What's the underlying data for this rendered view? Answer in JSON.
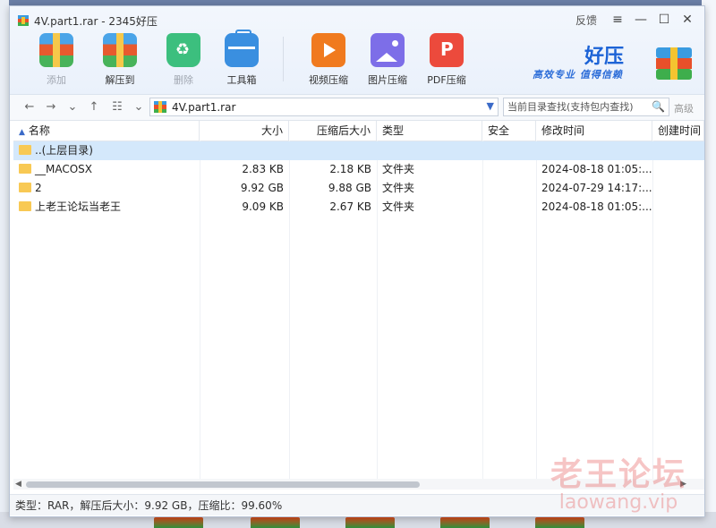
{
  "window": {
    "title": "4V.part1.rar - 2345好压"
  },
  "title_bar": {
    "feedback": "反馈"
  },
  "toolbar": {
    "add": "添加",
    "extract": "解压到",
    "delete": "删除",
    "tools": "工具箱",
    "video": "视频压缩",
    "image": "图片压缩",
    "pdf": "PDF压缩"
  },
  "brand": {
    "name": "好压",
    "slogan": "高效专业 值得信赖"
  },
  "address": {
    "path": "4V.part1.rar",
    "search_placeholder": "当前目录查找(支持包内查找)",
    "advanced": "高级"
  },
  "columns": {
    "name": "名称",
    "size": "大小",
    "packed": "压缩后大小",
    "type": "类型",
    "security": "安全",
    "modified": "修改时间",
    "created": "创建时间"
  },
  "files": [
    {
      "name": "..(上层目录)",
      "size": "",
      "packed": "",
      "type": "",
      "modified": ""
    },
    {
      "name": "__MACOSX",
      "size": "2.83 KB",
      "packed": "2.18 KB",
      "type": "文件夹",
      "modified": "2024-08-18 01:05:..."
    },
    {
      "name": "2",
      "size": "9.92 GB",
      "packed": "9.88 GB",
      "type": "文件夹",
      "modified": "2024-07-29 14:17:..."
    },
    {
      "name": "上老王论坛当老王",
      "size": "9.09 KB",
      "packed": "2.67 KB",
      "type": "文件夹",
      "modified": "2024-08-18 01:05:..."
    }
  ],
  "status": {
    "text": "类型：RAR，解压后大小：9.92 GB，压缩比：99.60%"
  },
  "watermark": {
    "line1": "老王论坛",
    "line2": "laowang.vip"
  }
}
